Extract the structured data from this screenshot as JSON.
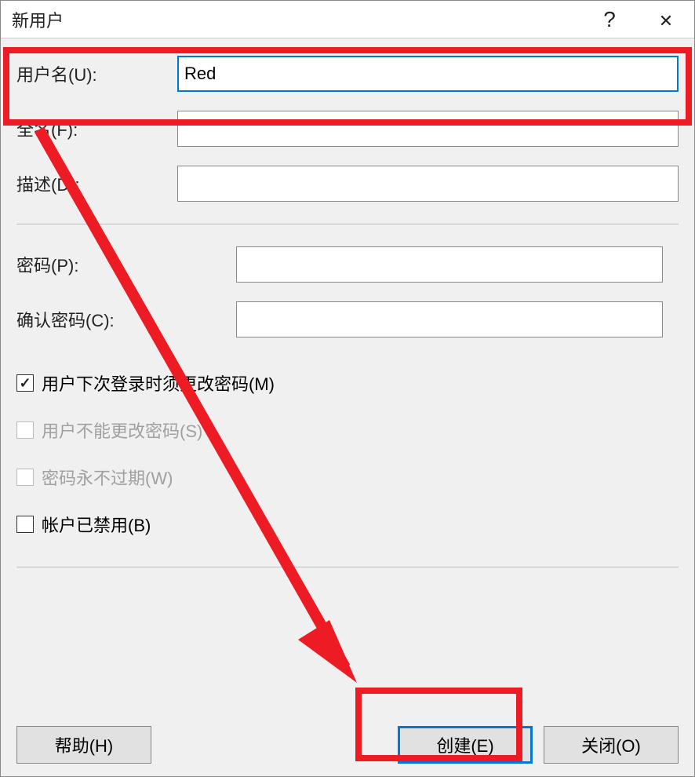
{
  "titlebar": {
    "title": "新用户"
  },
  "fields": {
    "username_label": "用户名(U):",
    "username_value": "Red",
    "fullname_label": "全名(F):",
    "fullname_value": "",
    "description_label": "描述(D):",
    "description_value": "",
    "password_label": "密码(P):",
    "password_value": "",
    "confirm_label": "确认密码(C):",
    "confirm_value": ""
  },
  "checkboxes": {
    "must_change_label": "用户下次登录时须更改密码(M)",
    "cannot_change_label": "用户不能更改密码(S)",
    "never_expires_label": "密码永不过期(W)",
    "disabled_label": "帐户已禁用(B)"
  },
  "buttons": {
    "help": "帮助(H)",
    "create": "创建(E)",
    "close": "关闭(O)"
  },
  "colors": {
    "highlight": "#ed1c24",
    "focus": "#0078d7"
  }
}
